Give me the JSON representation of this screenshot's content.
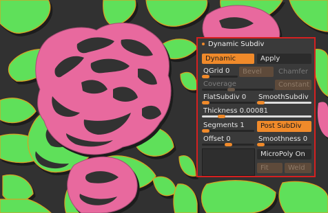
{
  "panel": {
    "title": "Dynamic Subdiv",
    "dynamic_label": "Dynamic",
    "apply_label": "Apply",
    "qgrid": {
      "label": "QGrid",
      "value": "0"
    },
    "bevel_label": "Bevel",
    "chamfer_label": "Chamfer",
    "coverage_label": "Coverage",
    "constant_label": "Constant",
    "flatsubdiv": {
      "label": "FlatSubdiv",
      "value": "0"
    },
    "smoothsubdiv_label": "SmoothSubdiv",
    "thickness": {
      "label": "Thickness",
      "value": "0.00081"
    },
    "segments": {
      "label": "Segments",
      "value": "1"
    },
    "post_subdiv_label": "Post SubDiv",
    "offset": {
      "label": "Offset",
      "value": "0"
    },
    "smoothness": {
      "label": "Smoothness",
      "value": "0"
    },
    "micropoly_label": "MicroPoly On",
    "fit_label": "Fit",
    "weld_label": "Weld"
  },
  "colors": {
    "accent": "#f08a2a",
    "panel_border": "#d62020",
    "rose_pink": "#e8699e",
    "leaf_green": "#5ee05a",
    "background": "#313131"
  },
  "icons": {
    "title_marker": "dot-icon"
  }
}
